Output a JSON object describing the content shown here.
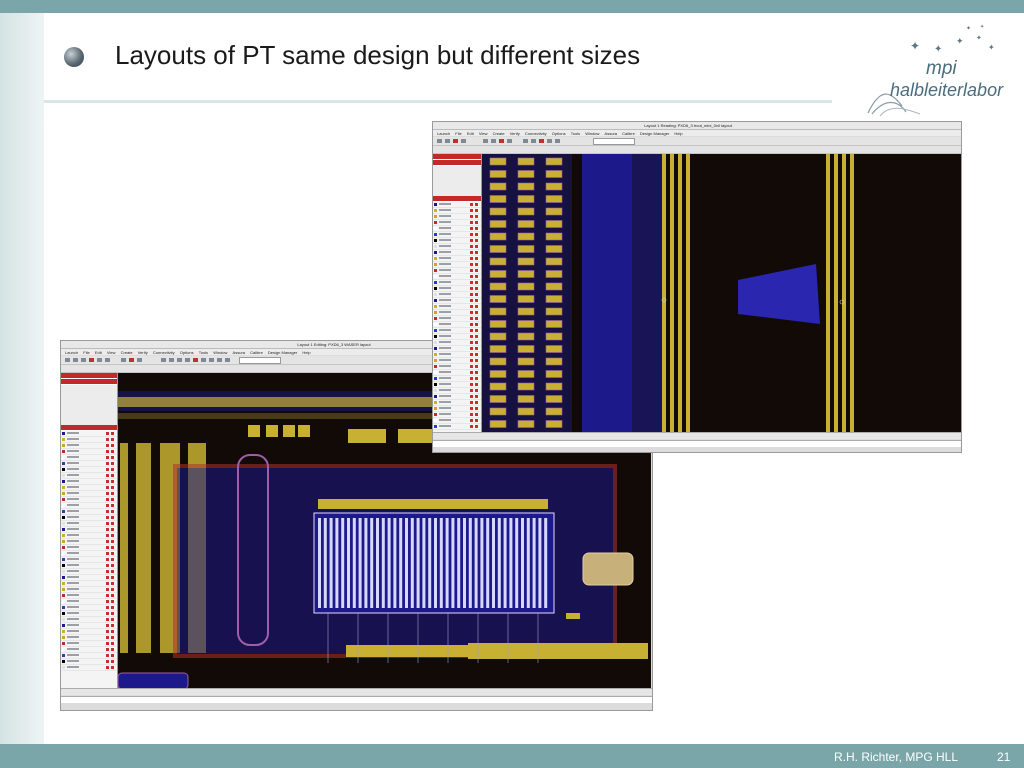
{
  "slide": {
    "title": "Layouts of PT same design but different sizes",
    "footer_author": "R.H. Richter, MPG HLL",
    "page_number": "21"
  },
  "logo": {
    "line1": "mpi",
    "line2": "halbleiterlabor"
  },
  "colors": {
    "frame": "#7aa6a9",
    "layout_background": "#120a07",
    "metal_blue": "#1c1a8a",
    "gate_yellow": "#c8b032",
    "outline_red": "#b2322a",
    "panel_header": "#c22a2a"
  },
  "screenshots": [
    {
      "id": "small",
      "window_title": "Layout 1 Reading: PXD6_3 trout_mini_0x0 layout",
      "menus": [
        "Launch",
        "File",
        "Edit",
        "View",
        "Create",
        "Verify",
        "Connectivity",
        "Options",
        "Tools",
        "Window",
        "Assura",
        "Calibre",
        "Design Manager",
        "Help"
      ]
    },
    {
      "id": "large",
      "window_title": "Layout 1 Editing: PXD6_3 WASER layout",
      "menus": [
        "Launch",
        "File",
        "Edit",
        "View",
        "Create",
        "Verify",
        "Connectivity",
        "Options",
        "Tools",
        "Window",
        "Assura",
        "Calibre",
        "Design Manager",
        "Help"
      ]
    }
  ]
}
